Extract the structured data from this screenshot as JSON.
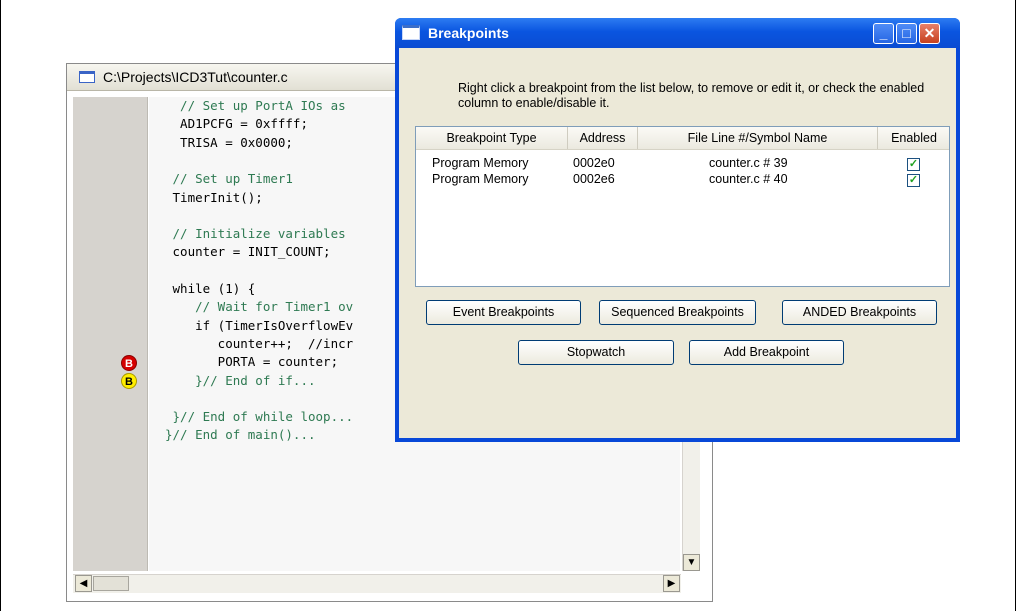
{
  "editor": {
    "title": "C:\\Projects\\ICD3Tut\\counter.c",
    "lines": [
      {
        "text": "  // Set up PortA IOs as",
        "cls": "c-com"
      },
      {
        "text": "  AD1PCFG = 0xffff;",
        "cls": ""
      },
      {
        "text": "  TRISA = 0x0000;",
        "cls": ""
      },
      {
        "text": "",
        "cls": ""
      },
      {
        "text": " // Set up Timer1",
        "cls": "c-com"
      },
      {
        "text": " TimerInit();",
        "cls": ""
      },
      {
        "text": "",
        "cls": ""
      },
      {
        "text": " // Initialize variables",
        "cls": "c-com"
      },
      {
        "text": " counter = INIT_COUNT;",
        "cls": ""
      },
      {
        "text": "",
        "cls": ""
      },
      {
        "text": " while (1) {",
        "cls": ""
      },
      {
        "text": "    // Wait for Timer1 ov",
        "cls": "c-com"
      },
      {
        "text": "    if (TimerIsOverflowEv",
        "cls": ""
      },
      {
        "text": "       counter++;  //incr",
        "cls": ""
      },
      {
        "text": "       PORTA = counter;",
        "cls": ""
      },
      {
        "text": "    }// End of if...",
        "cls": "c-com"
      },
      {
        "text": "",
        "cls": ""
      },
      {
        "text": " }// End of while loop...",
        "cls": "c-com"
      },
      {
        "text": "}// End of main()...",
        "cls": "c-com"
      }
    ],
    "breakpoint_markers": [
      "B",
      "B"
    ]
  },
  "dialog": {
    "title": "Breakpoints",
    "instructions": "Right click a breakpoint from the list below, to remove or edit it, or check the enabled column to enable/disable it.",
    "columns": [
      "Breakpoint Type",
      "Address",
      "File Line #/Symbol Name",
      "Enabled"
    ],
    "rows": [
      {
        "type": "Program Memory",
        "address": "0002e0",
        "location": "counter.c # 39",
        "enabled": true
      },
      {
        "type": "Program Memory",
        "address": "0002e6",
        "location": "counter.c # 40",
        "enabled": true
      }
    ],
    "buttons": {
      "event": "Event Breakpoints",
      "sequenced": "Sequenced Breakpoints",
      "anded": "ANDED Breakpoints",
      "stopwatch": "Stopwatch",
      "add": "Add Breakpoint"
    },
    "check_glyph": "✓"
  }
}
